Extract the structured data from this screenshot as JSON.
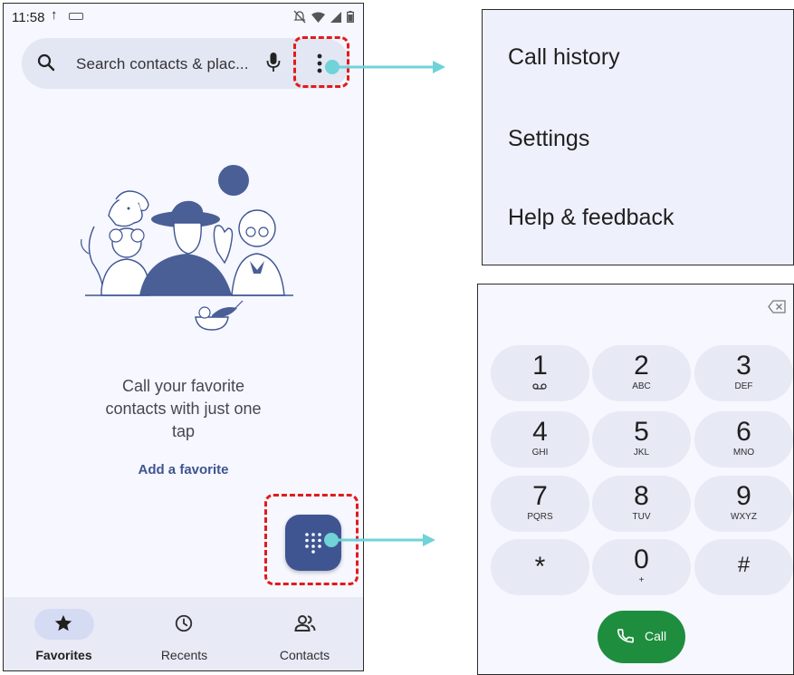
{
  "status_bar": {
    "time": "11:58"
  },
  "search": {
    "placeholder": "Search contacts & plac..."
  },
  "empty_state": {
    "message_lines": [
      "Call your favorite",
      "contacts with just one",
      "tap"
    ],
    "add_favorite_label": "Add a favorite"
  },
  "bottom_nav": {
    "items": [
      {
        "label": "Favorites",
        "icon": "star-icon",
        "active": true
      },
      {
        "label": "Recents",
        "icon": "clock-icon",
        "active": false
      },
      {
        "label": "Contacts",
        "icon": "people-icon",
        "active": false
      }
    ]
  },
  "overflow_menu": {
    "items": [
      "Call history",
      "Settings",
      "Help & feedback"
    ]
  },
  "dialpad": {
    "keys": [
      {
        "digit": "1",
        "letters": "voicemail-icon"
      },
      {
        "digit": "2",
        "letters": "ABC"
      },
      {
        "digit": "3",
        "letters": "DEF"
      },
      {
        "digit": "4",
        "letters": "GHI"
      },
      {
        "digit": "5",
        "letters": "JKL"
      },
      {
        "digit": "6",
        "letters": "MNO"
      },
      {
        "digit": "7",
        "letters": "PQRS"
      },
      {
        "digit": "8",
        "letters": "TUV"
      },
      {
        "digit": "9",
        "letters": "WXYZ"
      },
      {
        "digit": "*",
        "letters": ""
      },
      {
        "digit": "0",
        "letters": "+"
      },
      {
        "digit": "#",
        "letters": ""
      }
    ],
    "call_label": "Call"
  },
  "colors": {
    "accent": "#3f5592",
    "highlight": "#e11b1b",
    "arrow": "#6fd3d8",
    "call_green": "#1e8e3e"
  }
}
